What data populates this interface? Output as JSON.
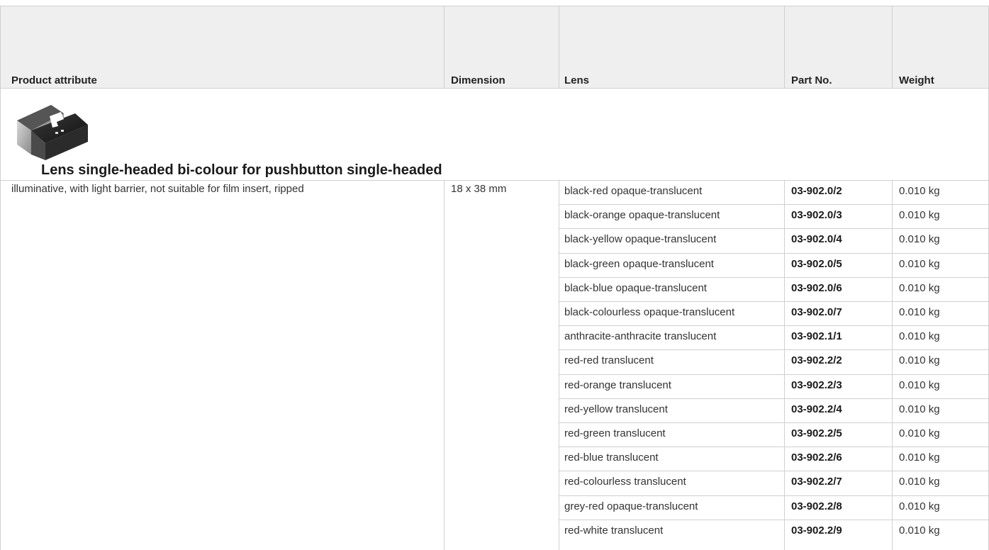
{
  "header": {
    "product_attribute": "Product attribute",
    "dimension": "Dimension",
    "lens": "Lens",
    "part_no": "Part No.",
    "weight": "Weight"
  },
  "product": {
    "title": "Lens single-headed bi-colour for pushbutton single-headed",
    "image_icon": "pushbutton-lens-product-photo",
    "attribute": "illuminative, with light barrier, not suitable for film insert, ripped",
    "dimension": "18 x 38 mm"
  },
  "rows": [
    {
      "lens": "black-red opaque-translucent",
      "part": "03-902.0/2",
      "weight": "0.010 kg"
    },
    {
      "lens": "black-orange opaque-translucent",
      "part": "03-902.0/3",
      "weight": "0.010 kg"
    },
    {
      "lens": "black-yellow opaque-translucent",
      "part": "03-902.0/4",
      "weight": "0.010 kg"
    },
    {
      "lens": "black-green opaque-translucent",
      "part": "03-902.0/5",
      "weight": "0.010 kg"
    },
    {
      "lens": "black-blue opaque-translucent",
      "part": "03-902.0/6",
      "weight": "0.010 kg"
    },
    {
      "lens": "black-colourless opaque-translucent",
      "part": "03-902.0/7",
      "weight": "0.010 kg"
    },
    {
      "lens": "anthracite-anthracite translucent",
      "part": "03-902.1/1",
      "weight": "0.010 kg"
    },
    {
      "lens": "red-red translucent",
      "part": "03-902.2/2",
      "weight": "0.010 kg"
    },
    {
      "lens": "red-orange translucent",
      "part": "03-902.2/3",
      "weight": "0.010 kg"
    },
    {
      "lens": "red-yellow translucent",
      "part": "03-902.2/4",
      "weight": "0.010 kg"
    },
    {
      "lens": "red-green translucent",
      "part": "03-902.2/5",
      "weight": "0.010 kg"
    },
    {
      "lens": "red-blue translucent",
      "part": "03-902.2/6",
      "weight": "0.010 kg"
    },
    {
      "lens": "red-colourless translucent",
      "part": "03-902.2/7",
      "weight": "0.010 kg"
    },
    {
      "lens": "grey-red opaque-translucent",
      "part": "03-902.2/8",
      "weight": "0.010 kg"
    },
    {
      "lens": "red-white translucent",
      "part": "03-902.2/9",
      "weight": "0.010 kg"
    }
  ]
}
